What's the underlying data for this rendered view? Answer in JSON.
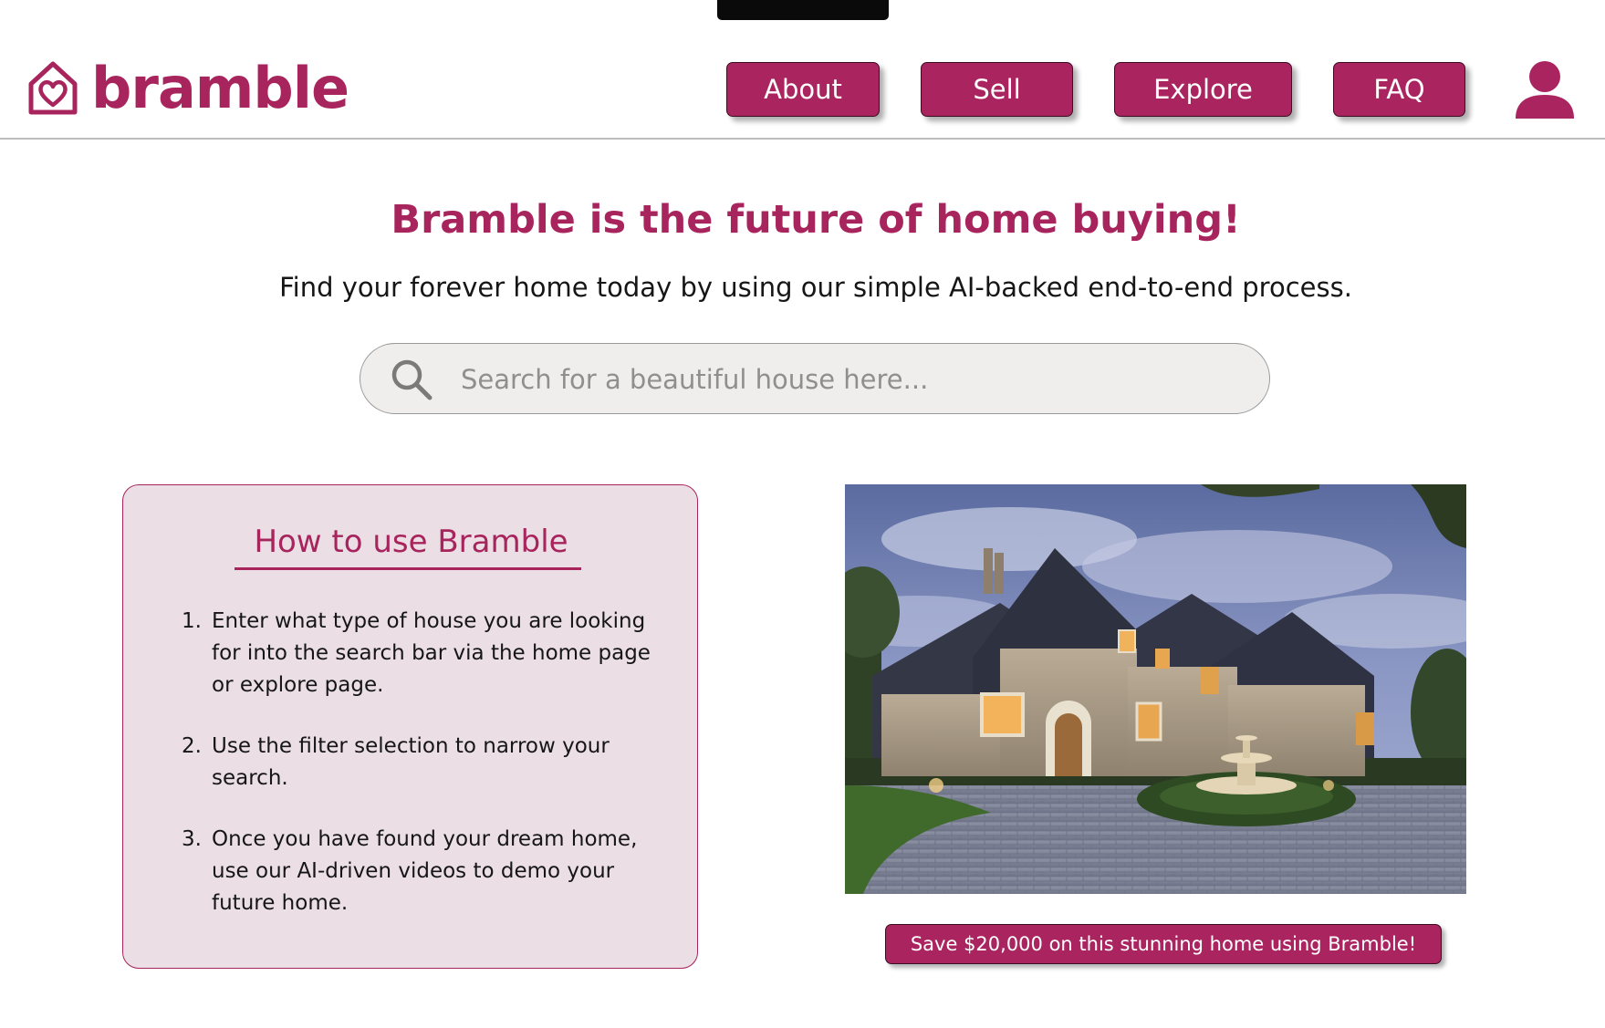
{
  "brand": {
    "name": "bramble",
    "logo_icon": "house-heart-icon",
    "accent_color": "#aa2560"
  },
  "nav": {
    "items": [
      {
        "label": "About"
      },
      {
        "label": "Sell"
      },
      {
        "label": "Explore"
      },
      {
        "label": "FAQ"
      }
    ],
    "account_icon": "user-icon"
  },
  "hero": {
    "headline": "Bramble is the future of home buying!",
    "subheadline": "Find your forever home today by using our simple AI-backed end-to-end process."
  },
  "search": {
    "placeholder": "Search for a beautiful house here...",
    "value": "",
    "icon": "search-icon"
  },
  "howto": {
    "title": "How to use Bramble",
    "steps": [
      {
        "number": "1.",
        "text": "Enter what type of house you are looking for into the search bar via the home page or explore page."
      },
      {
        "number": "2.",
        "text": "Use the filter selection to narrow your search."
      },
      {
        "number": "3.",
        "text": "Once you have found your dream home, use our AI-driven videos to demo your future home."
      }
    ]
  },
  "featured": {
    "image": "stone-house-photo",
    "promo_label": "Save $20,000 on this stunning home using Bramble!"
  }
}
